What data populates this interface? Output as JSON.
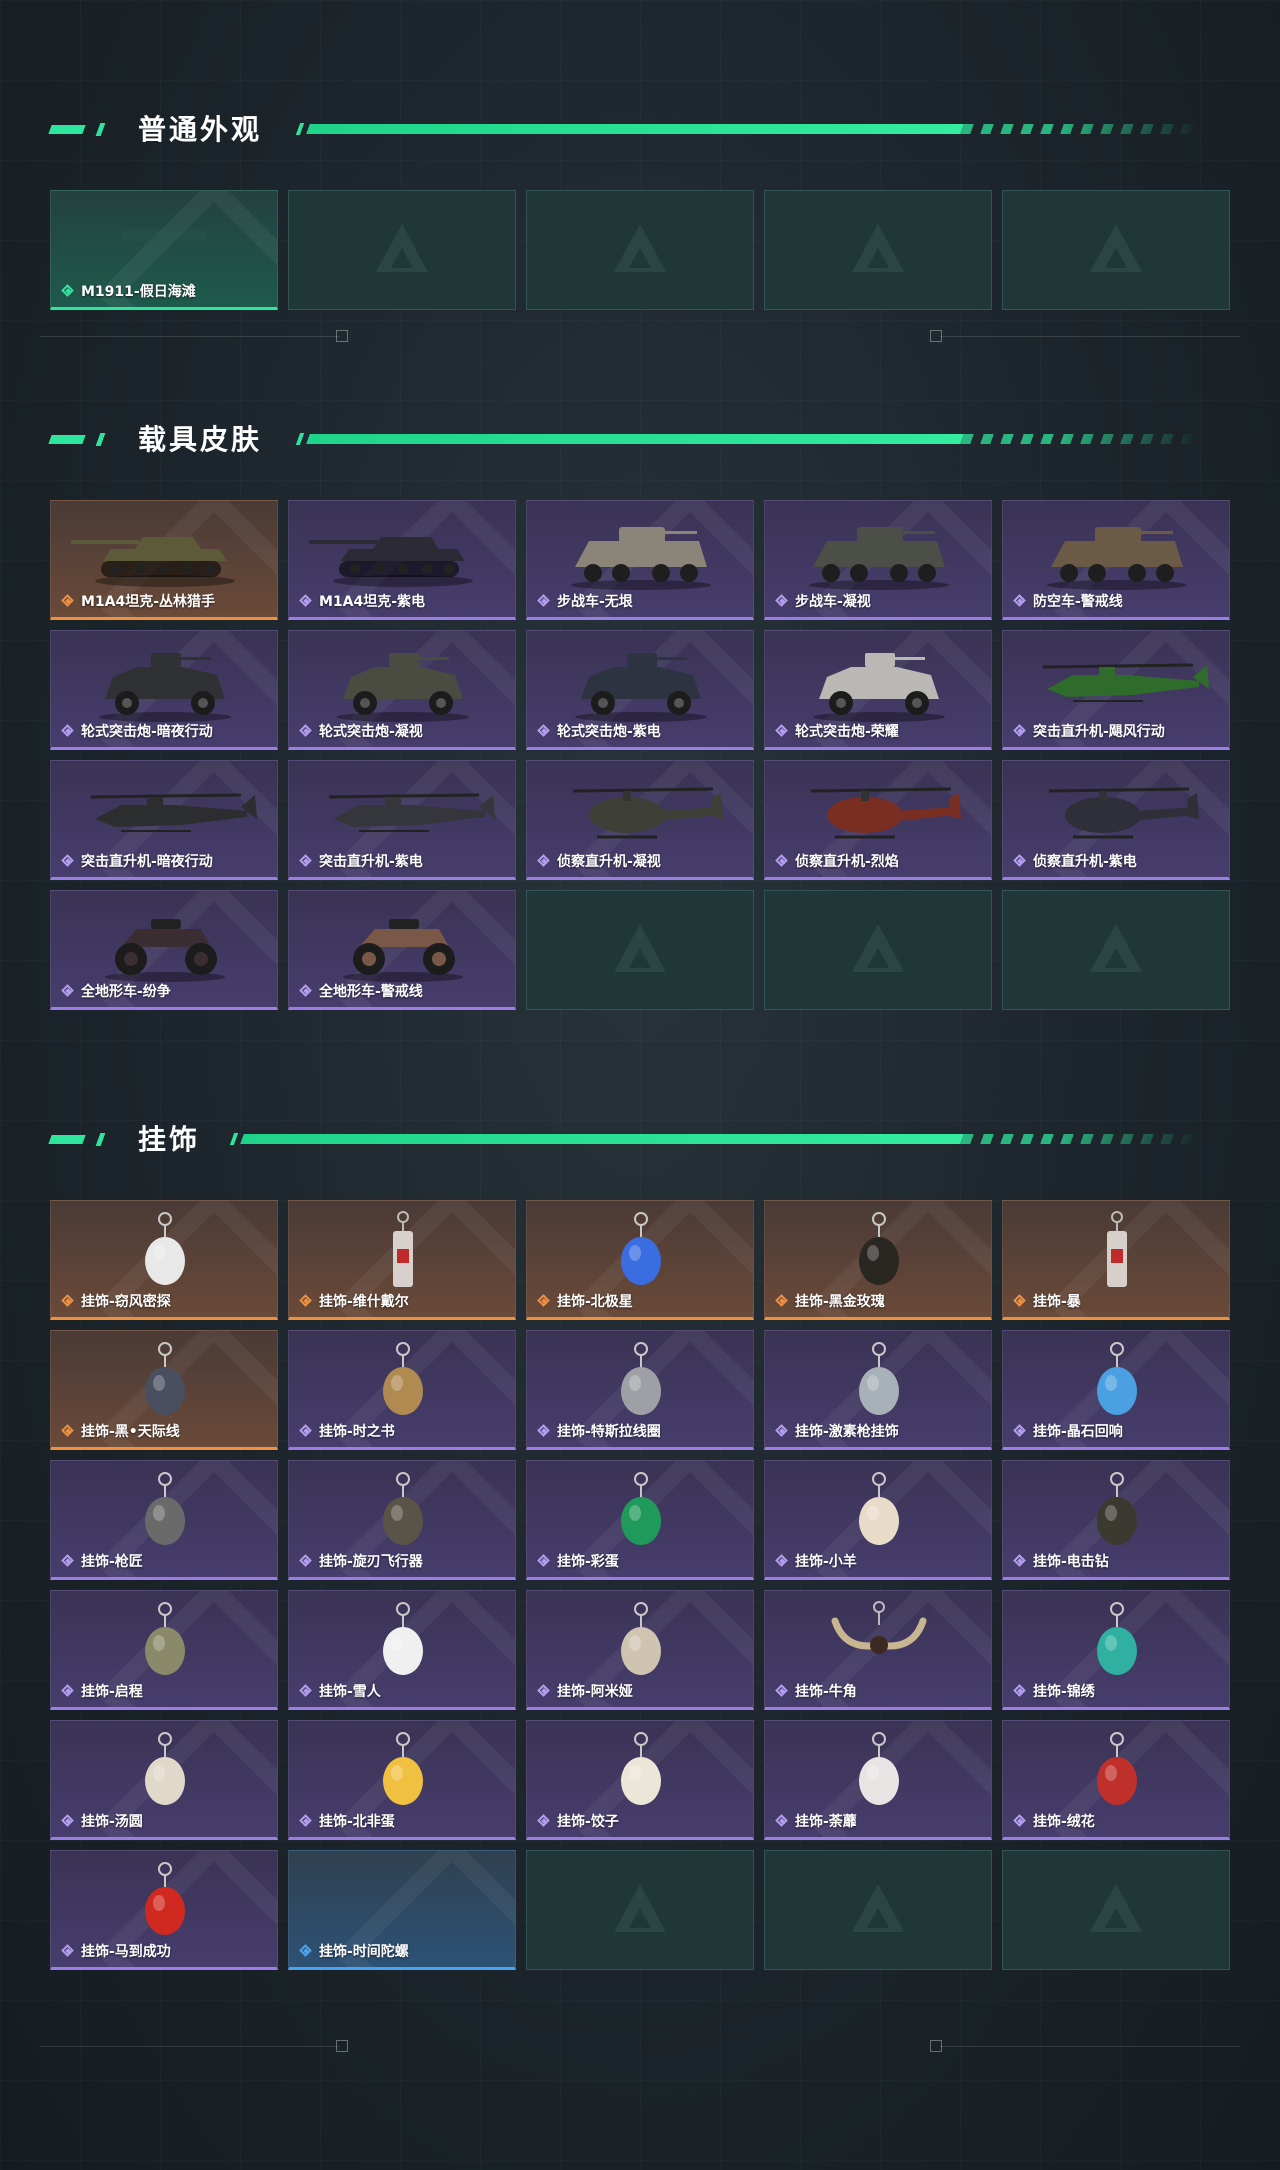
{
  "sections": [
    {
      "title": "普通外观",
      "items": [
        {
          "label": "M1911-假日海滩",
          "rarity": "green",
          "art": "pistol"
        },
        {
          "label": "",
          "rarity": "empty"
        },
        {
          "label": "",
          "rarity": "empty"
        },
        {
          "label": "",
          "rarity": "empty"
        },
        {
          "label": "",
          "rarity": "empty"
        }
      ]
    },
    {
      "title": "载具皮肤",
      "items": [
        {
          "label": "M1A4坦克-丛林猎手",
          "rarity": "orange",
          "art": "tank",
          "color": "#5d5a3a"
        },
        {
          "label": "M1A4坦克-紫电",
          "rarity": "purple",
          "art": "tank",
          "color": "#2c2b35"
        },
        {
          "label": "步战车-无垠",
          "rarity": "purple",
          "art": "apc",
          "color": "#8a8578"
        },
        {
          "label": "步战车-凝视",
          "rarity": "purple",
          "art": "apc",
          "color": "#4b4f47"
        },
        {
          "label": "防空车-警戒线",
          "rarity": "purple",
          "art": "apc",
          "color": "#6b5a45"
        },
        {
          "label": "轮式突击炮-暗夜行动",
          "rarity": "purple",
          "art": "jeep",
          "color": "#2f3134"
        },
        {
          "label": "轮式突击炮-凝视",
          "rarity": "purple",
          "art": "jeep",
          "color": "#4a4c42"
        },
        {
          "label": "轮式突击炮-紫电",
          "rarity": "purple",
          "art": "jeep",
          "color": "#2d3340"
        },
        {
          "label": "轮式突击炮-荣耀",
          "rarity": "purple",
          "art": "jeep",
          "color": "#b9b8b4"
        },
        {
          "label": "突击直升机-飓风行动",
          "rarity": "purple",
          "art": "heli",
          "color": "#2f6b2a"
        },
        {
          "label": "突击直升机-暗夜行动",
          "rarity": "purple",
          "art": "heli",
          "color": "#2b2d2f"
        },
        {
          "label": "突击直升机-紫电",
          "rarity": "purple",
          "art": "heli",
          "color": "#35363c"
        },
        {
          "label": "侦察直升机-凝视",
          "rarity": "purple",
          "art": "scout",
          "color": "#3e3f36"
        },
        {
          "label": "侦察直升机-烈焰",
          "rarity": "purple",
          "art": "scout",
          "color": "#7a2e22"
        },
        {
          "label": "侦察直升机-紫电",
          "rarity": "purple",
          "art": "scout",
          "color": "#2e2f38"
        },
        {
          "label": "全地形车-纷争",
          "rarity": "purple",
          "art": "atv",
          "color": "#3a2e33"
        },
        {
          "label": "全地形车-警戒线",
          "rarity": "purple",
          "art": "atv",
          "color": "#7a5848"
        },
        {
          "label": "",
          "rarity": "empty"
        },
        {
          "label": "",
          "rarity": "empty"
        },
        {
          "label": "",
          "rarity": "empty"
        }
      ]
    },
    {
      "title": "挂饰",
      "items": [
        {
          "label": "挂饰-窃风密探",
          "rarity": "orange",
          "art": "charm",
          "color": "#e8e8e8"
        },
        {
          "label": "挂饰-维什戴尔",
          "rarity": "orange",
          "art": "tag",
          "color": "#d8d0cc"
        },
        {
          "label": "挂饰-北极星",
          "rarity": "orange",
          "art": "charm",
          "color": "#3a6de0"
        },
        {
          "label": "挂饰-黑金玫瑰",
          "rarity": "orange",
          "art": "charm",
          "color": "#2a2622"
        },
        {
          "label": "挂饰-暴",
          "rarity": "orange",
          "art": "tag",
          "color": "#d6cfca"
        },
        {
          "label": "挂饰-黑•天际线",
          "rarity": "orange",
          "art": "charm",
          "color": "#4a4f60"
        },
        {
          "label": "挂饰-时之书",
          "rarity": "purple",
          "art": "charm",
          "color": "#b08a50"
        },
        {
          "label": "挂饰-特斯拉线圈",
          "rarity": "purple",
          "art": "charm",
          "color": "#9ea0a6"
        },
        {
          "label": "挂饰-激素枪挂饰",
          "rarity": "purple",
          "art": "charm",
          "color": "#a8b0b8"
        },
        {
          "label": "挂饰-晶石回响",
          "rarity": "purple",
          "art": "charm",
          "color": "#4aa0e0"
        },
        {
          "label": "挂饰-枪匠",
          "rarity": "purple",
          "art": "charm",
          "color": "#6a6a6a"
        },
        {
          "label": "挂饰-旋刃飞行器",
          "rarity": "purple",
          "art": "charm",
          "color": "#5a5448"
        },
        {
          "label": "挂饰-彩蛋",
          "rarity": "purple",
          "art": "charm",
          "color": "#1f9a5a"
        },
        {
          "label": "挂饰-小羊",
          "rarity": "purple",
          "art": "charm",
          "color": "#e8dcc8"
        },
        {
          "label": "挂饰-电击钻",
          "rarity": "purple",
          "art": "charm",
          "color": "#3a3a30"
        },
        {
          "label": "挂饰-启程",
          "rarity": "purple",
          "art": "charm",
          "color": "#8a8a6a"
        },
        {
          "label": "挂饰-雪人",
          "rarity": "purple",
          "art": "charm",
          "color": "#f0f0f0"
        },
        {
          "label": "挂饰-阿米娅",
          "rarity": "purple",
          "art": "charm",
          "color": "#cfc4b0"
        },
        {
          "label": "挂饰-牛角",
          "rarity": "purple",
          "art": "horns",
          "color": "#c8b690"
        },
        {
          "label": "挂饰-锦绣",
          "rarity": "purple",
          "art": "charm",
          "color": "#2fb0a0"
        },
        {
          "label": "挂饰-汤圆",
          "rarity": "purple",
          "art": "charm",
          "color": "#e0d8c8"
        },
        {
          "label": "挂饰-北非蛋",
          "rarity": "purple",
          "art": "charm",
          "color": "#f0c040"
        },
        {
          "label": "挂饰-饺子",
          "rarity": "purple",
          "art": "charm",
          "color": "#ece6d8"
        },
        {
          "label": "挂饰-荼蘼",
          "rarity": "purple",
          "art": "charm",
          "color": "#e8e4e4"
        },
        {
          "label": "挂饰-绒花",
          "rarity": "purple",
          "art": "charm",
          "color": "#c0302a"
        },
        {
          "label": "挂饰-马到成功",
          "rarity": "purple",
          "art": "charm",
          "color": "#d02a20"
        },
        {
          "label": "挂饰-时间陀螺",
          "rarity": "blue",
          "art": "none",
          "color": "#4aa3f0"
        },
        {
          "label": "",
          "rarity": "empty"
        },
        {
          "label": "",
          "rarity": "empty"
        },
        {
          "label": "",
          "rarity": "empty"
        }
      ]
    }
  ],
  "rarity_colors": {
    "green": "#2ee59d",
    "purple": "#b49cf0",
    "orange": "#f08f3c",
    "blue": "#4aa3f0"
  },
  "accent": "#2ee59d"
}
